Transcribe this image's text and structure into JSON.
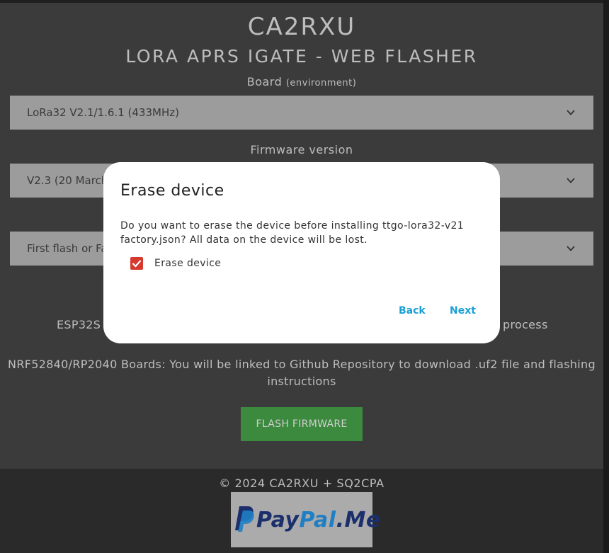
{
  "header": {
    "title": "CA2RXU",
    "subtitle": "LORA APRS IGATE - WEB FLASHER"
  },
  "board": {
    "label": "Board",
    "label_note": "(environment)",
    "selected": "LoRa32 V2.1/1.6.1 (433MHz)"
  },
  "firmware": {
    "label": "Firmware version",
    "selected": "V2.3 (20 March"
  },
  "mode": {
    "selected": "First flash or Fa"
  },
  "info": {
    "esp_partial": "ESP32S",
    "esp_tail": "process",
    "nrf_line1": "NRF52840/RP2040 Boards: You will be linked to Github Repository to download .uf2 file and flashing",
    "nrf_line2": "instructions"
  },
  "flash_button": "FLASH FIRMWARE",
  "footer": {
    "copyright": "© 2024 CA2RXU + SQ2CPA",
    "paypal_pay": "Pay",
    "paypal_pal": "Pal",
    "paypal_me": ".Me"
  },
  "dialog": {
    "title": "Erase device",
    "message_line1": "Do you want to erase the device before installing ttgo-lora32-v21",
    "message_line2": "factory.json? All data on the device will be lost.",
    "checkbox_label": "Erase device",
    "checkbox_checked": true,
    "back_label": "Back",
    "next_label": "Next"
  },
  "colors": {
    "accent_link": "#1a9fd6",
    "checkbox": "#d63a2f",
    "flash_button": "#3b8a3e"
  }
}
